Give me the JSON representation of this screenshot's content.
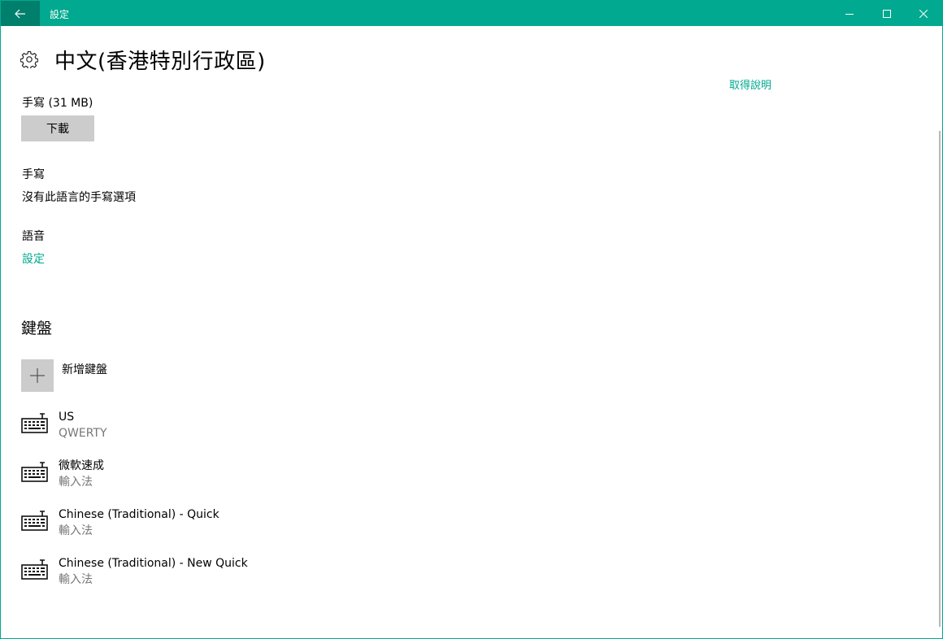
{
  "window": {
    "title": "設定",
    "accent_color": "#00a98f",
    "back_icon": "arrow-left-icon",
    "minimize_icon": "minimize-icon",
    "maximize_icon": "maximize-icon",
    "close_icon": "close-icon"
  },
  "page": {
    "icon": "gear-icon",
    "title": "中文(香港特別行政區)",
    "help_link": "取得說明"
  },
  "handwriting_download": {
    "label": "手寫 (31 MB)",
    "button_label": "下載"
  },
  "handwriting": {
    "label": "手寫",
    "description": "沒有此語言的手寫選項"
  },
  "speech": {
    "label": "語音",
    "settings_link": "設定"
  },
  "keyboards": {
    "section_title": "鍵盤",
    "add_label": "新增鍵盤",
    "add_icon": "plus-icon",
    "items": [
      {
        "name": "US",
        "subtitle": "QWERTY",
        "icon": "keyboard-icon"
      },
      {
        "name": "微軟速成",
        "subtitle": "輸入法",
        "icon": "keyboard-icon"
      },
      {
        "name": "Chinese (Traditional) - Quick",
        "subtitle": "輸入法",
        "icon": "keyboard-icon"
      },
      {
        "name": "Chinese (Traditional) - New Quick",
        "subtitle": "輸入法",
        "icon": "keyboard-icon"
      }
    ]
  }
}
